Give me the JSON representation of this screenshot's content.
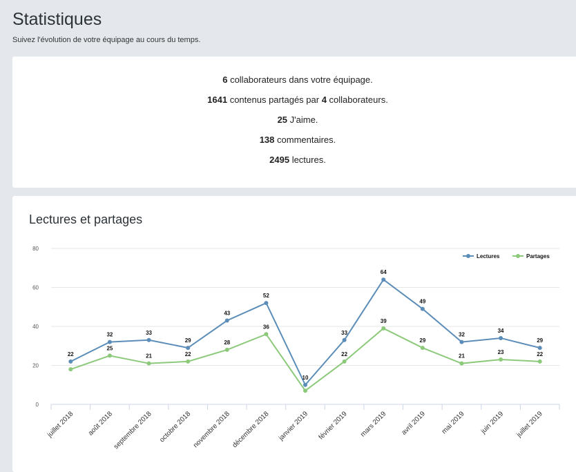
{
  "header": {
    "title": "Statistiques",
    "subtitle": "Suivez l'évolution de votre équipage au cours du temps."
  },
  "summary": {
    "collaborators": {
      "value": "6",
      "text": " collaborateurs dans votre équipage."
    },
    "shared": {
      "value": "1641",
      "text_mid": " contenus partagés par ",
      "value2": "4",
      "text_end": " collaborateurs."
    },
    "likes": {
      "value": "25",
      "text": " J'aime."
    },
    "comments": {
      "value": "138",
      "text": " commentaires."
    },
    "reads": {
      "value": "2495",
      "text": " lectures."
    }
  },
  "chart_data": {
    "type": "line",
    "title": "Lectures et partages",
    "categories": [
      "juillet 2018",
      "août 2018",
      "septembre 2018",
      "octobre 2018",
      "novembre 2018",
      "décembre 2018",
      "janvier 2019",
      "février 2019",
      "mars 2019",
      "avril 2019",
      "mai 2019",
      "juin 2019",
      "juillet 2019"
    ],
    "ylim": [
      0,
      80
    ],
    "yticks": [
      0,
      20,
      40,
      60,
      80
    ],
    "grid": true,
    "legend": "top-right",
    "series": [
      {
        "name": "Lectures",
        "color": "#5b8db8",
        "values": [
          22,
          32,
          33,
          29,
          43,
          52,
          10,
          33,
          64,
          49,
          32,
          34,
          29
        ]
      },
      {
        "name": "Partages",
        "color": "#8cc97a",
        "values": [
          18,
          25,
          21,
          22,
          28,
          36,
          7,
          22,
          39,
          29,
          21,
          23,
          22
        ]
      }
    ],
    "data_labels": [
      [
        22,
        32,
        33,
        29,
        43,
        52,
        10,
        33,
        64,
        49,
        32,
        34,
        29
      ],
      [
        null,
        25,
        21,
        22,
        28,
        36,
        null,
        22,
        39,
        29,
        21,
        23,
        22
      ]
    ]
  }
}
